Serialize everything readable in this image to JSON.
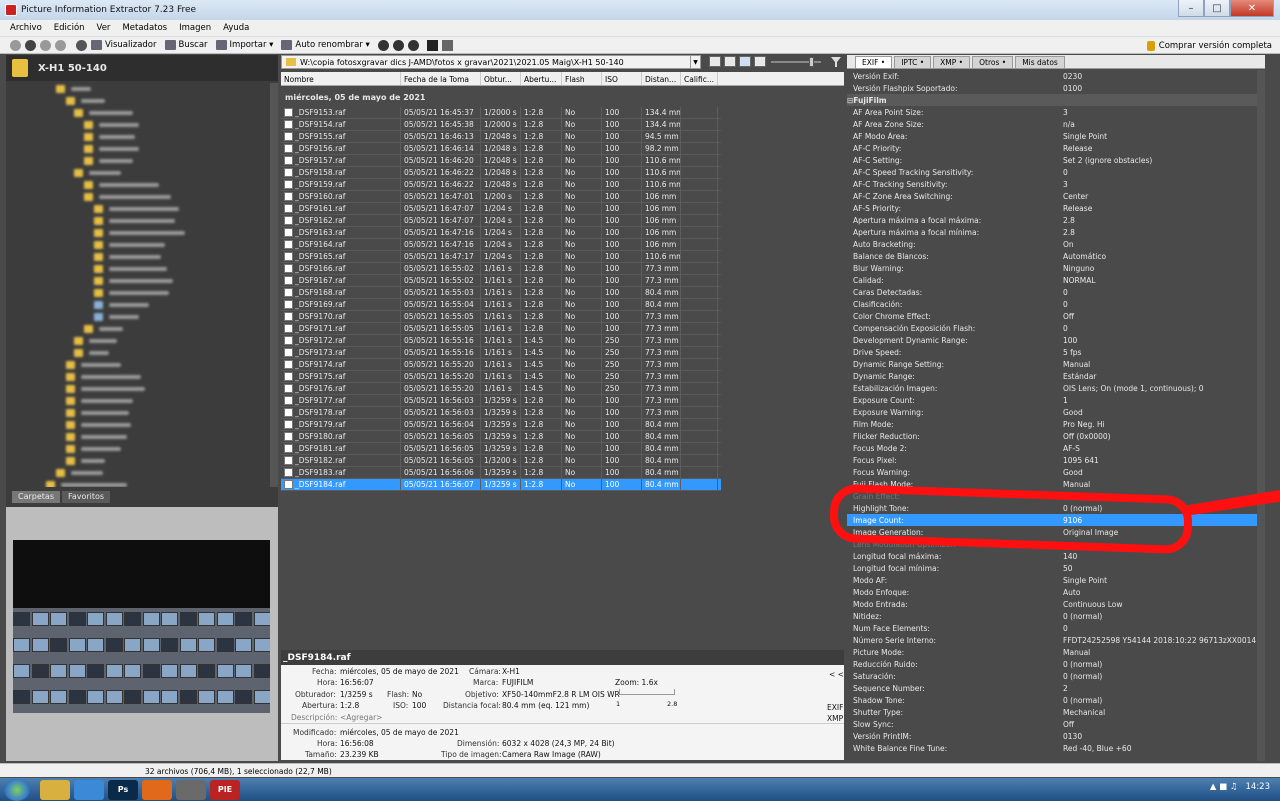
{
  "window": {
    "title": "Picture Information Extractor 7.23 Free"
  },
  "menu": [
    "Archivo",
    "Edición",
    "Ver",
    "Metadatos",
    "Imagen",
    "Ayuda"
  ],
  "toolbar": {
    "viewer": "Visualizador",
    "search": "Buscar",
    "import": "Importar",
    "autorename": "Auto renombrar",
    "buy": "Comprar versión completa"
  },
  "folder": {
    "name": "X-H1 50-140"
  },
  "left_tabs": [
    "Carpetas",
    "Favoritos"
  ],
  "path": "W:\\copia fotosxgravar dics J-AMD\\fotos x gravar\\2021\\2021.05 Maig\\X-H1 50-140",
  "columns": [
    "Nombre",
    "Fecha de la Toma",
    "Obtur...",
    "Abertu...",
    "Flash",
    "ISO",
    "Distan...",
    "Calific..."
  ],
  "group": "miércoles, 05 de mayo de 2021",
  "files": [
    [
      "_DSF9153.raf",
      "05/05/21 16:45:37",
      "1/2000 s",
      "1:2.8",
      "No",
      "100",
      "134.4 mm"
    ],
    [
      "_DSF9154.raf",
      "05/05/21 16:45:38",
      "1/2000 s",
      "1:2.8",
      "No",
      "100",
      "134.4 mm"
    ],
    [
      "_DSF9155.raf",
      "05/05/21 16:46:13",
      "1/2048 s",
      "1:2.8",
      "No",
      "100",
      "94.5 mm"
    ],
    [
      "_DSF9156.raf",
      "05/05/21 16:46:14",
      "1/2048 s",
      "1:2.8",
      "No",
      "100",
      "98.2 mm"
    ],
    [
      "_DSF9157.raf",
      "05/05/21 16:46:20",
      "1/2048 s",
      "1:2.8",
      "No",
      "100",
      "110.6 mm"
    ],
    [
      "_DSF9158.raf",
      "05/05/21 16:46:22",
      "1/2048 s",
      "1:2.8",
      "No",
      "100",
      "110.6 mm"
    ],
    [
      "_DSF9159.raf",
      "05/05/21 16:46:22",
      "1/2048 s",
      "1:2.8",
      "No",
      "100",
      "110.6 mm"
    ],
    [
      "_DSF9160.raf",
      "05/05/21 16:47:01",
      "1/200 s",
      "1:2.8",
      "No",
      "100",
      "106 mm"
    ],
    [
      "_DSF9161.raf",
      "05/05/21 16:47:07",
      "1/204 s",
      "1:2.8",
      "No",
      "100",
      "106 mm"
    ],
    [
      "_DSF9162.raf",
      "05/05/21 16:47:07",
      "1/204 s",
      "1:2.8",
      "No",
      "100",
      "106 mm"
    ],
    [
      "_DSF9163.raf",
      "05/05/21 16:47:16",
      "1/204 s",
      "1:2.8",
      "No",
      "100",
      "106 mm"
    ],
    [
      "_DSF9164.raf",
      "05/05/21 16:47:16",
      "1/204 s",
      "1:2.8",
      "No",
      "100",
      "106 mm"
    ],
    [
      "_DSF9165.raf",
      "05/05/21 16:47:17",
      "1/204 s",
      "1:2.8",
      "No",
      "100",
      "110.6 mm"
    ],
    [
      "_DSF9166.raf",
      "05/05/21 16:55:02",
      "1/161 s",
      "1:2.8",
      "No",
      "100",
      "77.3 mm"
    ],
    [
      "_DSF9167.raf",
      "05/05/21 16:55:02",
      "1/161 s",
      "1:2.8",
      "No",
      "100",
      "77.3 mm"
    ],
    [
      "_DSF9168.raf",
      "05/05/21 16:55:03",
      "1/161 s",
      "1:2.8",
      "No",
      "100",
      "80.4 mm"
    ],
    [
      "_DSF9169.raf",
      "05/05/21 16:55:04",
      "1/161 s",
      "1:2.8",
      "No",
      "100",
      "80.4 mm"
    ],
    [
      "_DSF9170.raf",
      "05/05/21 16:55:05",
      "1/161 s",
      "1:2.8",
      "No",
      "100",
      "77.3 mm"
    ],
    [
      "_DSF9171.raf",
      "05/05/21 16:55:05",
      "1/161 s",
      "1:2.8",
      "No",
      "100",
      "77.3 mm"
    ],
    [
      "_DSF9172.raf",
      "05/05/21 16:55:16",
      "1/161 s",
      "1:4.5",
      "No",
      "250",
      "77.3 mm"
    ],
    [
      "_DSF9173.raf",
      "05/05/21 16:55:16",
      "1/161 s",
      "1:4.5",
      "No",
      "250",
      "77.3 mm"
    ],
    [
      "_DSF9174.raf",
      "05/05/21 16:55:20",
      "1/161 s",
      "1:4.5",
      "No",
      "250",
      "77.3 mm"
    ],
    [
      "_DSF9175.raf",
      "05/05/21 16:55:20",
      "1/161 s",
      "1:4.5",
      "No",
      "250",
      "77.3 mm"
    ],
    [
      "_DSF9176.raf",
      "05/05/21 16:55:20",
      "1/161 s",
      "1:4.5",
      "No",
      "250",
      "77.3 mm"
    ],
    [
      "_DSF9177.raf",
      "05/05/21 16:56:03",
      "1/3259 s",
      "1:2.8",
      "No",
      "100",
      "77.3 mm"
    ],
    [
      "_DSF9178.raf",
      "05/05/21 16:56:03",
      "1/3259 s",
      "1:2.8",
      "No",
      "100",
      "77.3 mm"
    ],
    [
      "_DSF9179.raf",
      "05/05/21 16:56:04",
      "1/3259 s",
      "1:2.8",
      "No",
      "100",
      "80.4 mm"
    ],
    [
      "_DSF9180.raf",
      "05/05/21 16:56:05",
      "1/3259 s",
      "1:2.8",
      "No",
      "100",
      "80.4 mm"
    ],
    [
      "_DSF9181.raf",
      "05/05/21 16:56:05",
      "1/3259 s",
      "1:2.8",
      "No",
      "100",
      "80.4 mm"
    ],
    [
      "_DSF9182.raf",
      "05/05/21 16:56:05",
      "1/3200 s",
      "1:2.8",
      "No",
      "100",
      "80.4 mm"
    ],
    [
      "_DSF9183.raf",
      "05/05/21 16:56:06",
      "1/3259 s",
      "1:2.8",
      "No",
      "100",
      "80.4 mm"
    ],
    [
      "_DSF9184.raf",
      "05/05/21 16:56:07",
      "1/3259 s",
      "1:2.8",
      "No",
      "100",
      "80.4 mm"
    ]
  ],
  "info": {
    "filename": "_DSF9184.raf",
    "fecha_l": "Fecha:",
    "fecha": "miércoles, 05 de mayo de 2021",
    "hora_l": "Hora:",
    "hora": "16:56:07",
    "obt_l": "Obturador:",
    "obt": "1/3259 s",
    "flash_l": "Flash:",
    "flash": "No",
    "abert_l": "Abertura:",
    "abert": "1:2.8",
    "iso_l": "ISO:",
    "iso": "100",
    "desc_l": "Descripción:",
    "desc": "<Agregar>",
    "camara_l": "Cámara:",
    "camara": "X-H1",
    "marca_l": "Marca:",
    "marca": "FUJIFILM",
    "obj_l": "Objetivo:",
    "obj": "XF50-140mmF2.8 R LM OIS WR",
    "dist_l": "Distancia focal:",
    "dist": "80.4 mm (eq. 121 mm)",
    "zoom": "Zoom: 1.6x",
    "zmin": "1",
    "zmax": "2.8",
    "collapse": "< <",
    "exif": "EXIF",
    "xmp": "XMP",
    "mod_l": "Modificado:",
    "mod": "miércoles, 05 de mayo de 2021",
    "hora2": "16:56:08",
    "tam_l": "Tamaño:",
    "tam": "23.239 KB",
    "dim_l": "Dimensión:",
    "dim": "6032 x 4028 (24,3 MP, 24 Bit)",
    "tipo_l": "Tipo de imagen:",
    "tipo": "Camera Raw Image (RAW)"
  },
  "right_tabs": [
    "EXIF",
    "IPTC",
    "XMP",
    "Otros",
    "Mis datos"
  ],
  "props": [
    [
      "Versión Exif:",
      "0230",
      ""
    ],
    [
      "Versión Flashpix Soportado:",
      "0100",
      ""
    ],
    [
      "FujiFilm",
      "",
      "section"
    ],
    [
      "AF Area Point Size:",
      "3",
      ""
    ],
    [
      "AF Area Zone Size:",
      "n/a",
      ""
    ],
    [
      "AF Modo Área:",
      "Single Point",
      ""
    ],
    [
      "AF-C Priority:",
      "Release",
      ""
    ],
    [
      "AF-C Setting:",
      "Set 2 (ignore obstacles)",
      ""
    ],
    [
      "AF-C Speed Tracking Sensitivity:",
      "0",
      ""
    ],
    [
      "AF-C Tracking Sensitivity:",
      "3",
      ""
    ],
    [
      "AF-C Zone Area Switching:",
      "Center",
      ""
    ],
    [
      "AF-S Priority:",
      "Release",
      ""
    ],
    [
      "Apertura máxima a focal máxima:",
      "2.8",
      ""
    ],
    [
      "Apertura máxima a focal mínima:",
      "2.8",
      ""
    ],
    [
      "Auto Bracketing:",
      "On",
      ""
    ],
    [
      "Balance de Blancos:",
      "Automático",
      ""
    ],
    [
      "Blur Warning:",
      "Ninguno",
      ""
    ],
    [
      "Calidad:",
      "NORMAL",
      ""
    ],
    [
      "Caras Detectadas:",
      "0",
      ""
    ],
    [
      "Clasificación:",
      "0",
      ""
    ],
    [
      "Color Chrome Effect:",
      "Off",
      ""
    ],
    [
      "Compensación Exposición Flash:",
      "0",
      ""
    ],
    [
      "Development Dynamic Range:",
      "100",
      ""
    ],
    [
      "Drive Speed:",
      "5 fps",
      ""
    ],
    [
      "Dynamic Range Setting:",
      "Manual",
      ""
    ],
    [
      "Dynamic Range:",
      "Estándar",
      ""
    ],
    [
      "Estabilización Imagen:",
      "OIS Lens; On (mode 1, continuous); 0",
      ""
    ],
    [
      "Exposure Count:",
      "1",
      ""
    ],
    [
      "Exposure Warning:",
      "Good",
      ""
    ],
    [
      "Film Mode:",
      "Pro Neg. Hi",
      ""
    ],
    [
      "Flicker Reduction:",
      "Off (0x0000)",
      ""
    ],
    [
      "Focus Mode 2:",
      "AF-S",
      ""
    ],
    [
      "Focus Pixel:",
      "1095 641",
      ""
    ],
    [
      "Focus Warning:",
      "Good",
      ""
    ],
    [
      "Fuji Flash Mode:",
      "Manual",
      ""
    ],
    [
      "Grain Effect:",
      "",
      ""
    ],
    [
      "Highlight Tone:",
      "0 (normal)",
      ""
    ],
    [
      "Image Count:",
      "9106",
      "sel"
    ],
    [
      "Image Generation:",
      "Original Image",
      ""
    ],
    [
      "Lens Modulation Optimizer:",
      "",
      ""
    ],
    [
      "Longitud focal máxima:",
      "140",
      ""
    ],
    [
      "Longitud focal mínima:",
      "50",
      ""
    ],
    [
      "Modo AF:",
      "Single Point",
      ""
    ],
    [
      "Modo Enfoque:",
      "Auto",
      ""
    ],
    [
      "Modo Entrada:",
      "Continuous Low",
      ""
    ],
    [
      "Nitidez:",
      "0 (normal)",
      ""
    ],
    [
      "Num Face Elements:",
      "0",
      ""
    ],
    [
      "Número Serie Interno:",
      "FFDT24252598     Y54144 2018:10:22 96713zXX0014",
      ""
    ],
    [
      "Picture Mode:",
      "Manual",
      ""
    ],
    [
      "Reducción Ruido:",
      "0 (normal)",
      ""
    ],
    [
      "Saturación:",
      "0 (normal)",
      ""
    ],
    [
      "Sequence Number:",
      "2",
      ""
    ],
    [
      "Shadow Tone:",
      "0 (normal)",
      ""
    ],
    [
      "Shutter Type:",
      "Mechanical",
      ""
    ],
    [
      "Slow Sync:",
      "Off",
      ""
    ],
    [
      "Versión PrintIM:",
      "0130",
      ""
    ],
    [
      "White Balance Fine Tune:",
      "Red -40, Blue +60",
      ""
    ]
  ],
  "status": "32 archivos (706,4 MB), 1 seleccionado (22,7 MB)",
  "taskbar": {
    "ps": "Ps",
    "pie": "PIE",
    "time": "14:23"
  },
  "colors": {
    "selection": "#3399ff",
    "annotation": "#ff1010"
  }
}
